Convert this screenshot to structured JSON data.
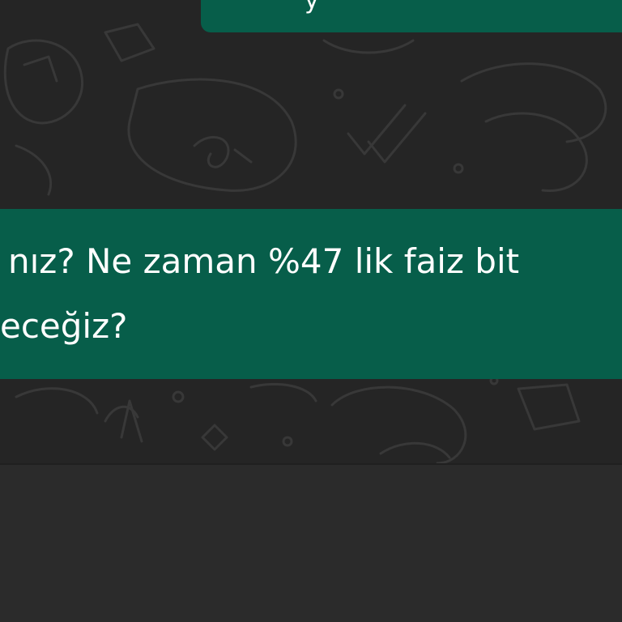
{
  "chat": {
    "top_bubble_fragment": "y",
    "message_lines": [
      "nız? Ne zaman %47 lik faiz bit",
      "eceğiz?"
    ]
  },
  "colors": {
    "outgoing_bubble": "#075e4a",
    "chat_background": "#252525",
    "composer_background": "#2b2b2b",
    "doodle_stroke": "#383838"
  }
}
